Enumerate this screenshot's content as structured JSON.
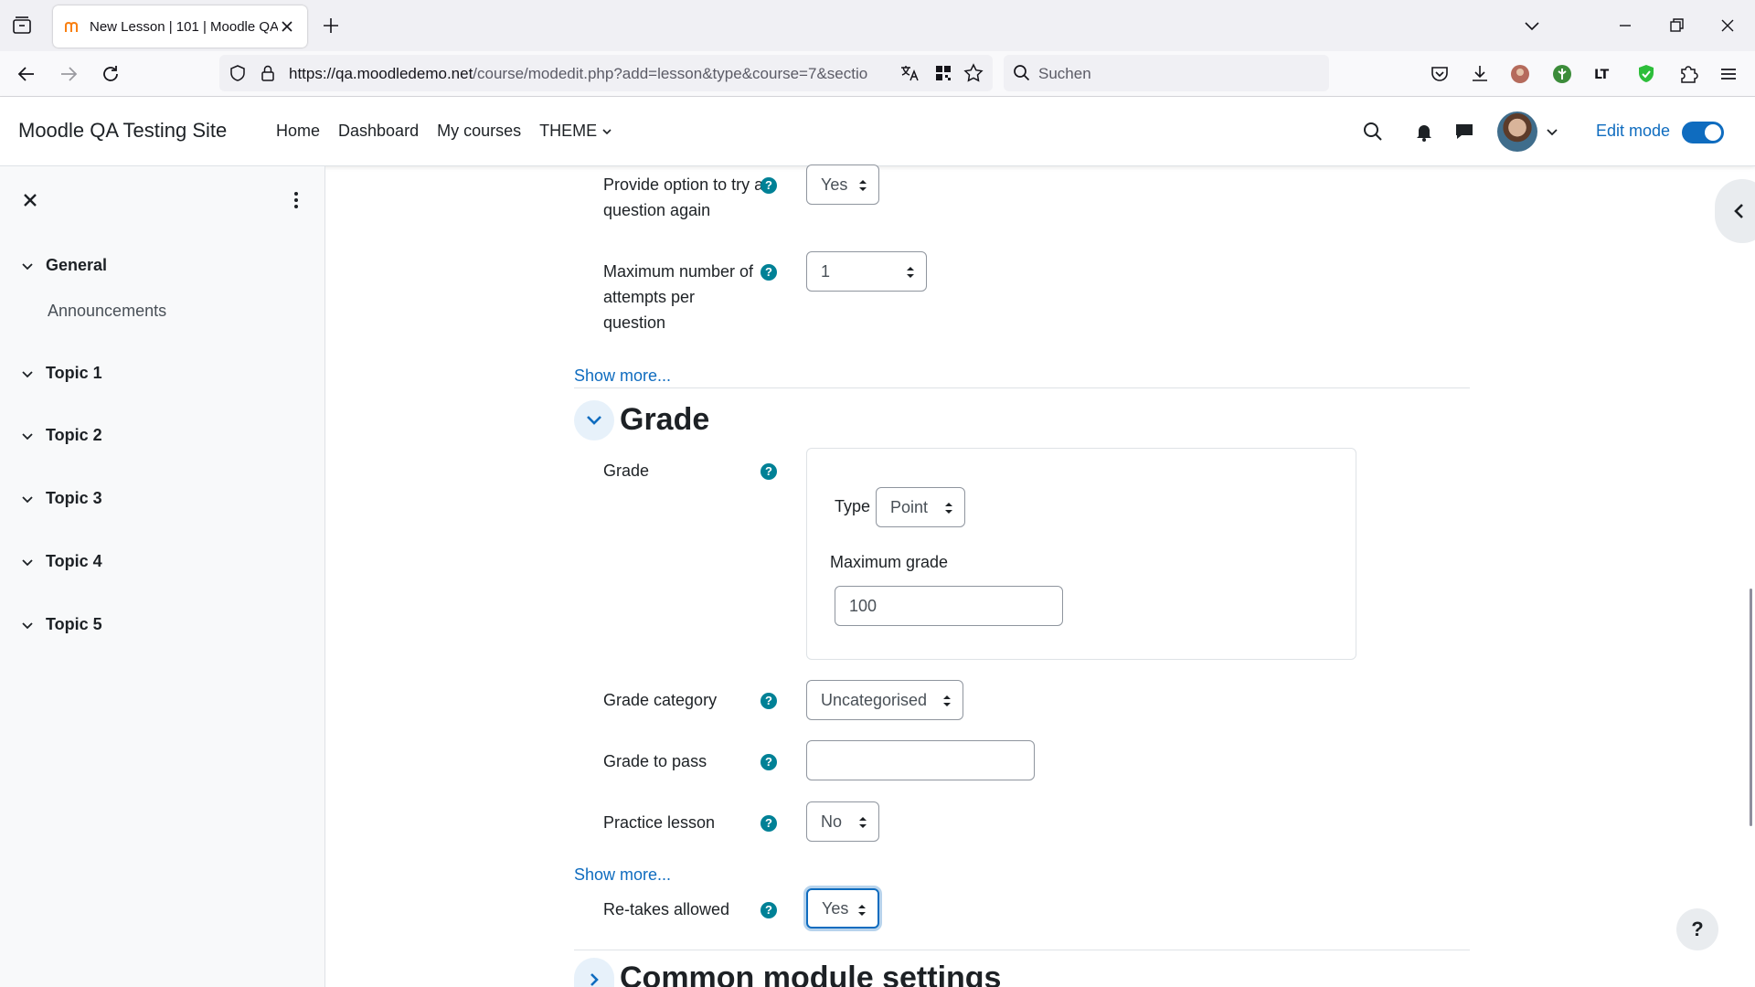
{
  "browser": {
    "tab_title": "New Lesson | 101 | Moodle QA",
    "url_host": "https://qa.moodledemo.net",
    "url_path": "/course/modedit.php?add=lesson&type&course=7&sectio",
    "search_placeholder": "Suchen"
  },
  "header": {
    "site_name": "Moodle QA Testing Site",
    "nav": [
      "Home",
      "Dashboard",
      "My courses",
      "THEME"
    ],
    "edit_mode_label": "Edit mode"
  },
  "course_index": {
    "sections": [
      {
        "label": "General",
        "items": [
          "Announcements"
        ]
      },
      {
        "label": "Topic 1"
      },
      {
        "label": "Topic 2"
      },
      {
        "label": "Topic 3"
      },
      {
        "label": "Topic 4"
      },
      {
        "label": "Topic 5"
      }
    ]
  },
  "form": {
    "try_again_label": "Provide option to try a question again",
    "try_again_value": "Yes",
    "max_attempts_label": "Maximum number of attempts per question",
    "max_attempts_value": "1",
    "show_more": "Show more...",
    "grade_section_title": "Grade",
    "grade_label": "Grade",
    "type_label": "Type",
    "type_value": "Point",
    "max_grade_label": "Maximum grade",
    "max_grade_value": "100",
    "grade_category_label": "Grade category",
    "grade_category_value": "Uncategorised",
    "grade_to_pass_label": "Grade to pass",
    "grade_to_pass_value": "",
    "practice_label": "Practice lesson",
    "practice_value": "No",
    "retakes_label": "Re-takes allowed",
    "retakes_value": "Yes",
    "common_section_title": "Common module settings"
  },
  "help_glyph": "?",
  "colors": {
    "accent": "#0f6cbf",
    "help": "#008196"
  }
}
